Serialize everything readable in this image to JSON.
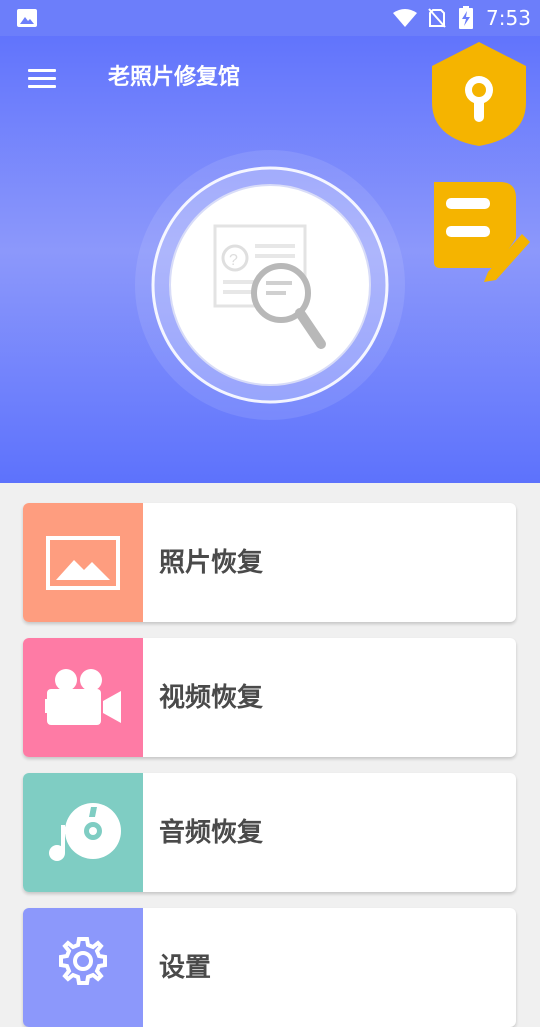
{
  "status_bar": {
    "time": "7:53"
  },
  "header": {
    "title": "老照片修复馆"
  },
  "menu": [
    {
      "label": "照片恢复",
      "icon": "image-icon",
      "color": "#fe9d7f"
    },
    {
      "label": "视频恢复",
      "icon": "video-camera-icon",
      "color": "#fe7ba5"
    },
    {
      "label": "音频恢复",
      "icon": "music-disc-icon",
      "color": "#7fcdc3"
    },
    {
      "label": "设置",
      "icon": "gear-icon",
      "color": "#8c98fb"
    }
  ],
  "colors": {
    "primary": "#5a6efc",
    "badge": "#f5b400"
  }
}
